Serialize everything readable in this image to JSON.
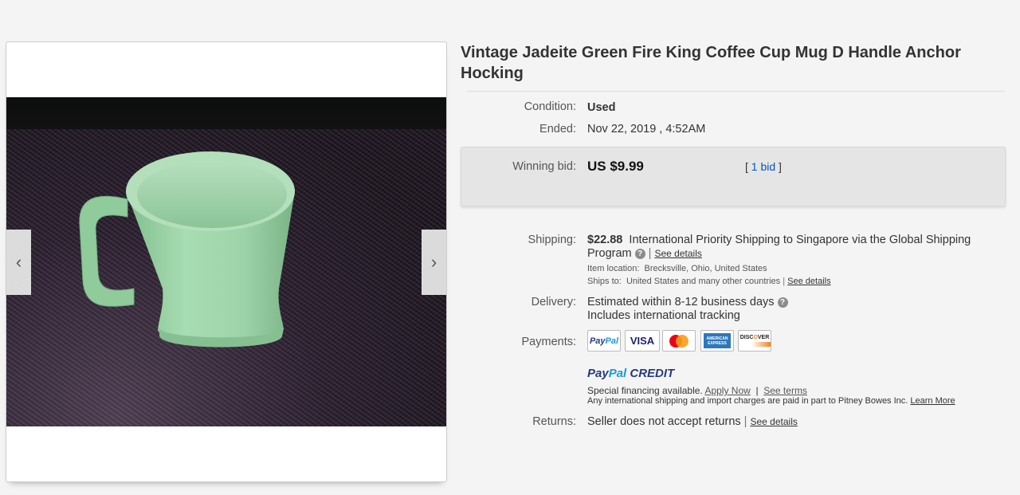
{
  "listing": {
    "title": "Vintage Jadeite Green Fire King Coffee Cup Mug D Handle Anchor Hocking"
  },
  "gallery": {
    "prev_icon": "chevron-left-icon",
    "next_icon": "chevron-right-icon",
    "prev_glyph": "‹",
    "next_glyph": "›"
  },
  "details": {
    "condition_label": "Condition:",
    "condition_value": "Used",
    "ended_label": "Ended:",
    "ended_value": "Nov 22, 2019 , 4:52AM"
  },
  "bid": {
    "label": "Winning bid:",
    "price": "US $9.99",
    "count_open": "[",
    "count_link": "1 bid",
    "count_close": "]"
  },
  "shipping": {
    "label": "Shipping:",
    "cost": "$22.88",
    "method_line1": "International Priority Shipping to Singapore  via the Global Shipping",
    "method_line2": "Program",
    "see_details": "See details",
    "location_label": "Item location:",
    "location_value": "Brecksville, Ohio, United States",
    "ships_label": "Ships to:",
    "ships_value": "United States and many other countries",
    "ships_see_details": "See details"
  },
  "delivery": {
    "label": "Delivery:",
    "line1": "Estimated within 8-12 business days",
    "line2": "Includes international tracking"
  },
  "payments": {
    "label": "Payments:",
    "cards": [
      "PayPal",
      "VISA",
      "mastercard",
      "AMERICAN EXPRESS",
      "DISCOVER"
    ],
    "paypal_credit": "PayPal CREDIT",
    "financing_text": "Special financing available.",
    "apply_now": "Apply Now",
    "see_terms": "See terms",
    "disclaimer": "Any international shipping and import charges are paid in part to Pitney Bowes Inc.",
    "learn_more": "Learn More"
  },
  "returns": {
    "label": "Returns:",
    "value": "Seller does not accept returns",
    "see_details": "See details"
  },
  "colors": {
    "link": "#0654ba",
    "mug": "#9fd3a8",
    "paypal_dark": "#253b80",
    "paypal_light": "#179bd7"
  }
}
